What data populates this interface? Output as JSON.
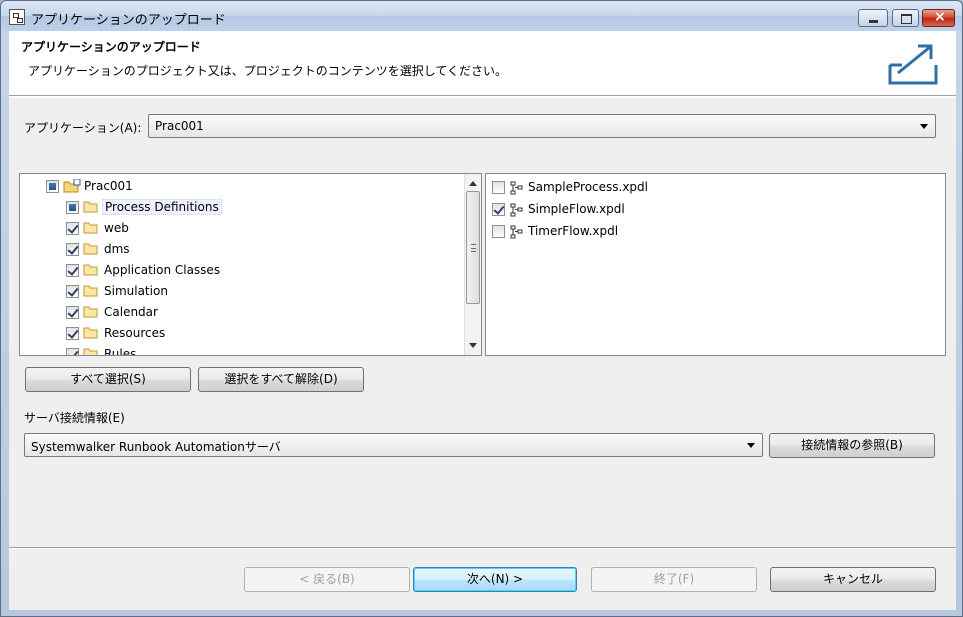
{
  "window": {
    "title": "アプリケーションのアップロード"
  },
  "header": {
    "title": "アプリケーションのアップロード",
    "description": "アプリケーションのプロジェクト又は、プロジェクトのコンテンツを選択してください。",
    "icon": "upload-icon"
  },
  "application": {
    "label": "アプリケーション(A):",
    "selected": "Prac001"
  },
  "tree": {
    "root": {
      "label": "Prac001",
      "state": "partial"
    },
    "items": [
      {
        "label": "Process Definitions",
        "state": "partial"
      },
      {
        "label": "web",
        "state": "checked"
      },
      {
        "label": "dms",
        "state": "checked"
      },
      {
        "label": "Application Classes",
        "state": "checked"
      },
      {
        "label": "Simulation",
        "state": "checked"
      },
      {
        "label": "Calendar",
        "state": "checked"
      },
      {
        "label": "Resources",
        "state": "checked"
      },
      {
        "label": "Rules",
        "state": "checked"
      }
    ]
  },
  "files": [
    {
      "label": "SampleProcess.xpdl",
      "checked": false
    },
    {
      "label": "SimpleFlow.xpdl",
      "checked": true
    },
    {
      "label": "TimerFlow.xpdl",
      "checked": false
    }
  ],
  "buttons": {
    "select_all": "すべて選択(S)",
    "deselect_all": "選択をすべて解除(D)",
    "browse_connection": "接続情報の参照(B)",
    "back": "< 戻る(B)",
    "next": "次へ(N) >",
    "finish": "終了(F)",
    "cancel": "キャンセル"
  },
  "server": {
    "label": "サーバ接続情報(E)",
    "selected": "Systemwalker Runbook Automationサーバ"
  }
}
